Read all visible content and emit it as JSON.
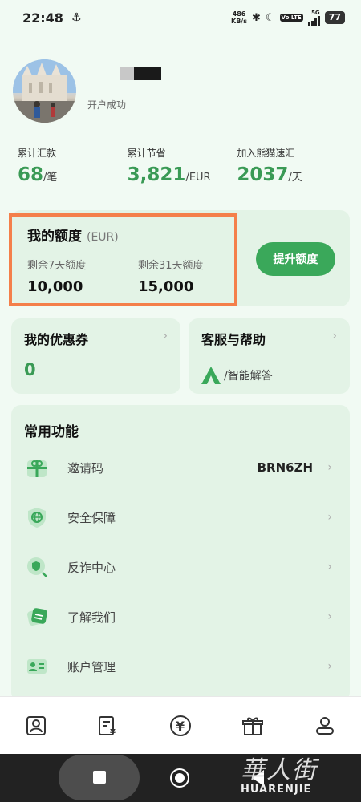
{
  "status_bar": {
    "time": "22:48",
    "net_speed_value": "486",
    "net_speed_unit": "KB/s",
    "network": "5G",
    "volte": "Vo LTE",
    "battery": "77"
  },
  "profile": {
    "status": "开户成功"
  },
  "stats": [
    {
      "label": "累计汇款",
      "value": "68",
      "unit": "/笔"
    },
    {
      "label": "累计节省",
      "value": "3,821",
      "unit": "/EUR"
    },
    {
      "label": "加入熊猫速汇",
      "value": "2037",
      "unit": "/天"
    }
  ],
  "quota": {
    "title": "我的额度",
    "currency": "(EUR)",
    "seven_day_label": "剩余7天额度",
    "seven_day_value": "10,000",
    "thirtyone_day_label": "剩余31天额度",
    "thirtyone_day_value": "15,000",
    "upgrade_button": "提升额度"
  },
  "coupon": {
    "title": "我的优惠券",
    "count": "0"
  },
  "service": {
    "title": "客服与帮助",
    "subtitle": "/智能解答"
  },
  "features": {
    "title": "常用功能",
    "items": [
      {
        "label": "邀请码",
        "value": "BRN6ZH",
        "icon": "gift-icon"
      },
      {
        "label": "安全保障",
        "value": "",
        "icon": "shield-globe-icon"
      },
      {
        "label": "反诈中心",
        "value": "",
        "icon": "shield-search-icon"
      },
      {
        "label": "了解我们",
        "value": "",
        "icon": "chat-cards-icon"
      },
      {
        "label": "账户管理",
        "value": "",
        "icon": "id-card-icon"
      }
    ]
  },
  "bottom_nav": [
    {
      "icon": "contacts-icon"
    },
    {
      "icon": "bill-yen-icon"
    },
    {
      "icon": "yen-circle-icon"
    },
    {
      "icon": "gift-box-icon"
    },
    {
      "icon": "user-profile-icon"
    }
  ],
  "watermark": {
    "cn": "華人街",
    "en": "HUARENJIE"
  },
  "colors": {
    "accent_green": "#3aa85a",
    "highlight_orange": "#f47f4a",
    "card_bg": "#e3f3e6",
    "page_bg": "#f1faf3"
  }
}
